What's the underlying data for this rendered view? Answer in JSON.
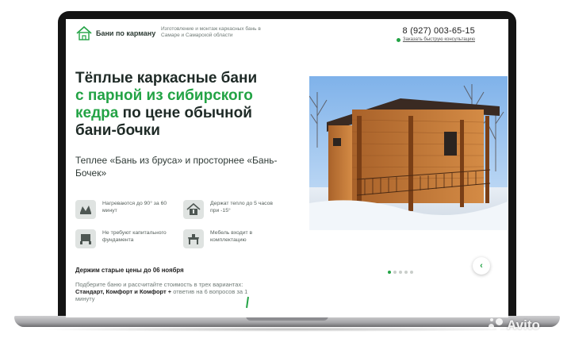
{
  "header": {
    "brand": "Бани по карману",
    "tagline": "Изготовление и монтаж каркасных бань в Самаре и Самарской области",
    "phone": "8 (927) 003-65-15",
    "callback_link": "Заказать быструю консультацию"
  },
  "hero": {
    "headline_line1": "Тёплые каркасные бани",
    "headline_accent": "с парной из сибирского кедра",
    "headline_line3": "по цене обычной бани-бочки",
    "subhead": "Теплее «Бань из бруса» и просторнее «Бань-Бочек»"
  },
  "features": [
    {
      "icon": "heat-icon",
      "text": "Нагреваются до 90° за 60 минут"
    },
    {
      "icon": "house-thermometer-icon",
      "text": "Держат тепло до 5 часов при -15°"
    },
    {
      "icon": "foundation-icon",
      "text": "Не требуют капитального фундамента"
    },
    {
      "icon": "furniture-icon",
      "text": "Мебель входит в комплектацию"
    }
  ],
  "promo": {
    "prices_note": "Держим старые цены до 06 ноября",
    "quiz_lead": "Подберите баню и рассчитайте стоимость в трех вариантах:",
    "quiz_options": "Стандарт, Комфорт и Комфорт +",
    "quiz_tail": "ответив на 6 вопросов за 1 минуту"
  },
  "slider": {
    "total": 5,
    "active": 1
  },
  "watermark": {
    "text": "Avito"
  },
  "colors": {
    "accent": "#23a345",
    "text": "#1e2a26"
  }
}
